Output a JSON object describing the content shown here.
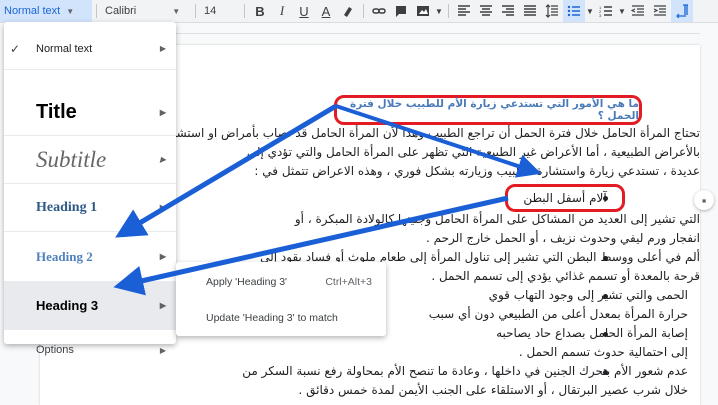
{
  "toolbar": {
    "style_value": "Normal text",
    "font_value": "Calibri",
    "size_value": "14",
    "bold": "B",
    "italic": "I",
    "underline": "U",
    "text_color": "A"
  },
  "style_menu": {
    "normal": "Normal text",
    "title": "Title",
    "subtitle": "Subtitle",
    "heading1": "Heading 1",
    "heading2": "Heading 2",
    "heading3": "Heading 3",
    "options": "Options"
  },
  "sub_menu": {
    "apply": "Apply 'Heading 3'",
    "shortcut": "Ctrl+Alt+3",
    "update": "Update 'Heading 3' to match"
  },
  "document": {
    "question_heading": "ما هي الأمور التي تستدعي زيارة الأم للطبيب خلال فترة الحمل ؟",
    "line1": "تحتاج المرأة الحامل خلال فترة الحمل أن تراجع الطبيب وهذا لأن المرأة الحامل قد تصاب بأمراض او استشارته وهذا",
    "line2": "بالأعراض الطبيعية ، أما الأعراض غير الطبيعية التي تظهر على المرأة الحامل والتي تؤدي إلى",
    "line3": "عديدة ، تستدعي زيارة واستشارة الطبيب وزيارته بشكل فوري ، وهذه الاعراض تتمثل في :",
    "bullet1": "آلام أسفل البطن",
    "line5": "التي تشير إلى العديد من المشاكل على المرأة الحامل وجنينها كالولادة المبكرة ، أو",
    "line6": "انفجار ورم ليفي وحدوث نزيف ، أو الحمل خارج الرحم .",
    "line7": "ألم في أعلى ووسط البطن التي تشير إلى تناول المرأة إلى طعام ملوث أو فساد يقود إلى",
    "line8": "قرحة بالمعدة أو تسمم غذائي يؤدي إلى تسمم الحمل .",
    "line9": "الحمى والتي تشير إلى وجود التهاب قوي",
    "line10": "حرارة المرأة بمعدل أعلى من الطبيعي دون أي سبب",
    "line11": "إصابة المرأة الحامل بصداع حاد يصاحبه",
    "line12": "إلى احتمالية حدوث تسمم الحمل .",
    "line13": "عدم شعور الأم بتحرك الجنين في داخلها ، وعادة ما تنصح الأم بمحاولة رفع نسبة السكر من",
    "line14": "خلال شرب عصير البرتقال ، أو الاستلقاء على الجنب الأيمن لمدة خمس دقائق ."
  }
}
